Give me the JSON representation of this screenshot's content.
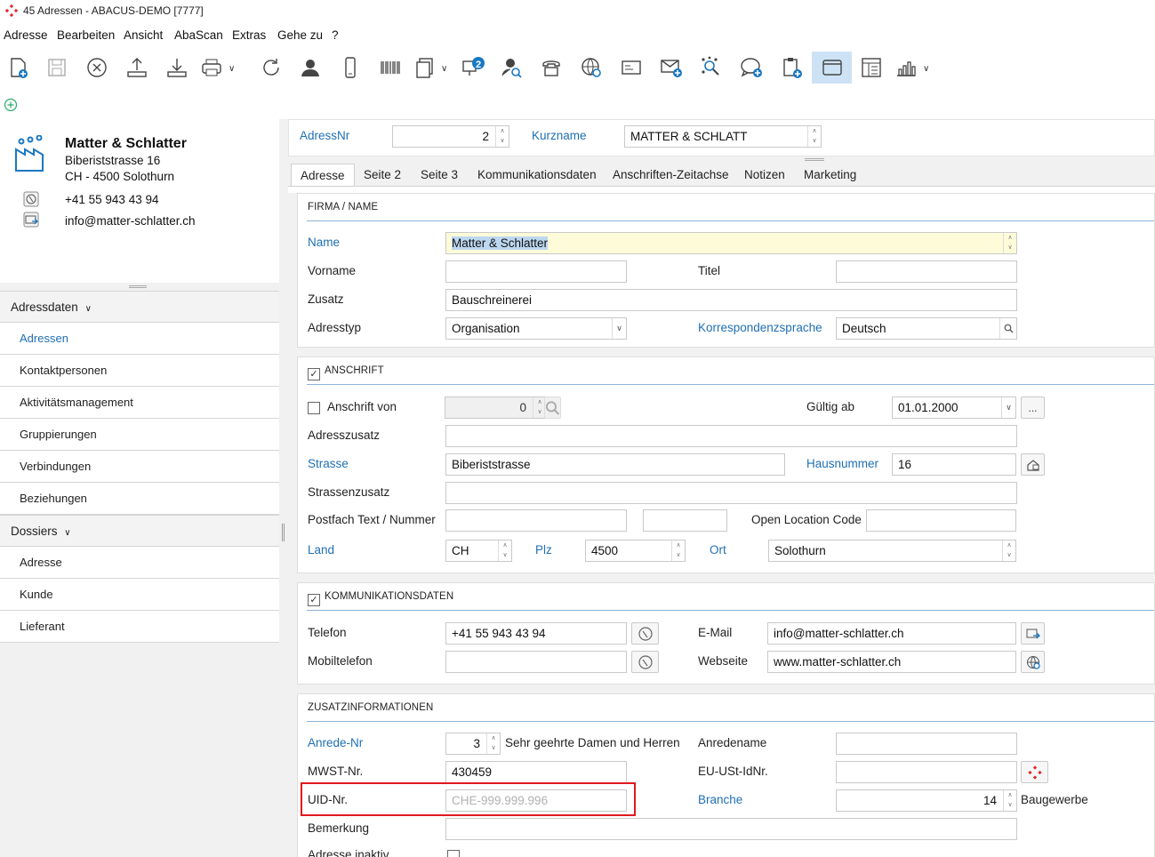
{
  "window": {
    "title": "45 Adressen - ABACUS-DEMO [7777]"
  },
  "menu": [
    "Adresse",
    "Bearbeiten",
    "Ansicht",
    "AbaScan",
    "Extras",
    "Gehe zu",
    "?"
  ],
  "toolbar": {
    "icons": [
      "new-document-icon",
      "save-icon",
      "cancel-icon",
      "upload-icon",
      "download-icon",
      "print-icon",
      "refresh-icon",
      "contact-icon",
      "mobile-icon",
      "barcode-icon",
      "documents-icon",
      "notes-icon",
      "person-search-icon",
      "phone-icon",
      "web-search-icon",
      "card-icon",
      "mail-add-icon",
      "network-search-icon",
      "chat-add-icon",
      "clipboard-add-icon",
      "window-icon",
      "layout-icon",
      "chart-icon"
    ],
    "notes_badge": "2"
  },
  "card": {
    "name": "Matter & Schlatter",
    "street": "Biberiststrasse 16",
    "city": "CH - 4500 Solothurn",
    "phone": "+41 55 943 43 94",
    "email": "info@matter-schlatter.ch"
  },
  "nav": {
    "section1": "Adressdaten",
    "items1": [
      "Adressen",
      "Kontaktpersonen",
      "Aktivitätsmanagement",
      "Gruppierungen",
      "Verbindungen",
      "Beziehungen"
    ],
    "section2": "Dossiers",
    "items2": [
      "Adresse",
      "Kunde",
      "Lieferant"
    ]
  },
  "header": {
    "adressnr_label": "AdressNr",
    "adressnr_value": "2",
    "kurzname_label": "Kurzname",
    "kurzname_value": "MATTER & SCHLATT"
  },
  "tabs": [
    "Adresse",
    "Seite 2",
    "Seite 3",
    "Kommunikationsdaten",
    "Anschriften-Zeitachse",
    "Notizen",
    "Marketing"
  ],
  "firma": {
    "title": "FIRMA / NAME",
    "name_label": "Name",
    "name_value": "Matter & Schlatter",
    "vorname_label": "Vorname",
    "vorname_value": "",
    "titel_label": "Titel",
    "titel_value": "",
    "zusatz_label": "Zusatz",
    "zusatz_value": "Bauschreinerei",
    "adresstyp_label": "Adresstyp",
    "adresstyp_value": "Organisation",
    "sprache_label": "Korrespondenzsprache",
    "sprache_value": "Deutsch"
  },
  "anschrift": {
    "title": "ANSCHRIFT",
    "anschrift_von_label": "Anschrift von",
    "anschrift_von_value": "0",
    "gueltig_label": "Gültig ab",
    "gueltig_value": "01.01.2000",
    "adresszusatz_label": "Adresszusatz",
    "strasse_label": "Strasse",
    "strasse_value": "Biberiststrasse",
    "hausnummer_label": "Hausnummer",
    "hausnummer_value": "16",
    "strassenzusatz_label": "Strassenzusatz",
    "postfach_label": "Postfach Text / Nummer",
    "olc_label": "Open Location Code",
    "land_label": "Land",
    "land_value": "CH",
    "plz_label": "Plz",
    "plz_value": "4500",
    "ort_label": "Ort",
    "ort_value": "Solothurn",
    "more_button": "..."
  },
  "komm": {
    "title": "KOMMUNIKATIONSDATEN",
    "telefon_label": "Telefon",
    "telefon_value": "+41 55 943 43 94",
    "mobil_label": "Mobiltelefon",
    "mobil_value": "",
    "email_label": "E-Mail",
    "email_value": "info@matter-schlatter.ch",
    "web_label": "Webseite",
    "web_value": "www.matter-schlatter.ch"
  },
  "zusatz": {
    "title": "ZUSATZINFORMATIONEN",
    "anrede_label": "Anrede-Nr",
    "anrede_value": "3",
    "anrede_text": "Sehr geehrte Damen und Herren",
    "anredename_label": "Anredename",
    "mwst_label": "MWST-Nr.",
    "mwst_value": "430459",
    "eu_label": "EU-USt-IdNr.",
    "uid_label": "UID-Nr.",
    "uid_placeholder": "CHE-999.999.996",
    "branche_label": "Branche",
    "branche_value": "14",
    "branche_text": "Baugewerbe",
    "bemerkung_label": "Bemerkung",
    "inaktiv_label": "Adresse inaktiv"
  }
}
